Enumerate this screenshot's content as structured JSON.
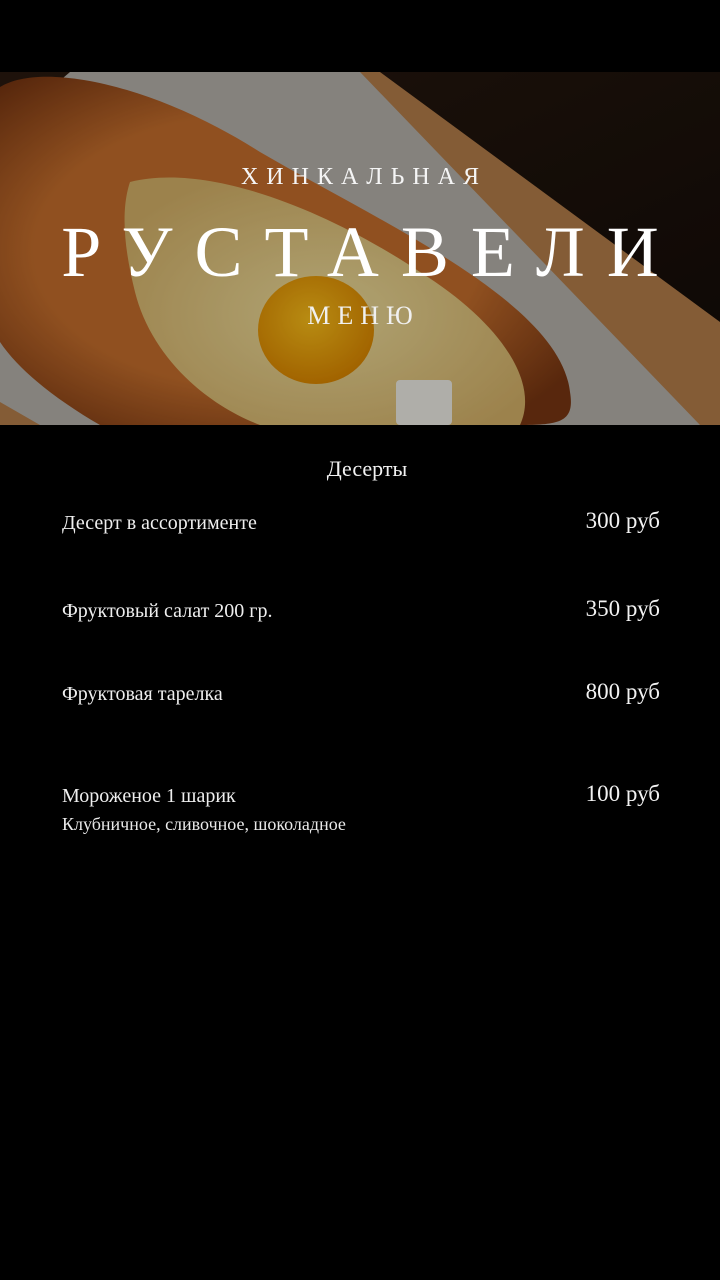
{
  "header": {
    "subtitle_top": "ХИНКАЛЬНАЯ",
    "brand": "РУСТАВЕЛИ",
    "subtitle_bottom": "МЕНЮ"
  },
  "section": {
    "title": "Десерты"
  },
  "items": [
    {
      "name": "Десерт в ассортименте",
      "price": "300 руб"
    },
    {
      "name": "Фруктовый салат 200 гр.",
      "price": "350 руб"
    },
    {
      "name": "Фруктовая тарелка",
      "price": "800 руб"
    },
    {
      "name": "Мороженое 1 шарик",
      "description": "Клубничное, сливочное, шоколадное",
      "price": "100 руб"
    }
  ]
}
